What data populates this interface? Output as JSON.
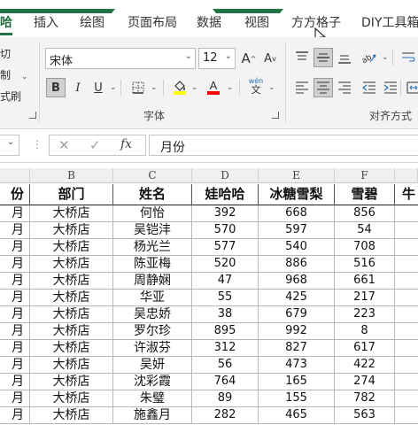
{
  "tabs": [
    {
      "label": "哈",
      "active": true
    },
    {
      "label": "插入"
    },
    {
      "label": "绘图"
    },
    {
      "label": "页面布局"
    },
    {
      "label": "数据"
    },
    {
      "label": "视图"
    },
    {
      "label": "方方格子"
    },
    {
      "label": "DIY工具箱"
    }
  ],
  "clipboard": {
    "cut": "切",
    "copy": "制",
    "format_painter": "式刷"
  },
  "font": {
    "name": "宋体",
    "size": "12",
    "grow_label": "A",
    "shrink_label": "A",
    "bold": "B",
    "italic": "I",
    "underline": "U",
    "phonetic_top": "wén",
    "phonetic_bottom": "文",
    "group_label": "字体"
  },
  "alignment": {
    "group_label": "对齐方式"
  },
  "colors": {
    "accent": "#217346",
    "highlight": "#ffff00",
    "font_color": "#ff0000"
  },
  "formula_bar": {
    "cancel": "✕",
    "confirm": "✓",
    "fx": "fx",
    "value": "月份"
  },
  "columns": [
    "B",
    "C",
    "D",
    "E",
    "F"
  ],
  "table": {
    "headers": [
      "份",
      "部门",
      "姓名",
      "娃哈哈",
      "冰糖雪梨",
      "雪碧",
      "牛"
    ],
    "rows": [
      [
        "月",
        "大桥店",
        "何怡",
        "392",
        "668",
        "856"
      ],
      [
        "月",
        "大桥店",
        "吴铠沣",
        "570",
        "597",
        "54"
      ],
      [
        "月",
        "大桥店",
        "杨光兰",
        "577",
        "540",
        "708"
      ],
      [
        "月",
        "大桥店",
        "陈亚梅",
        "520",
        "886",
        "516"
      ],
      [
        "月",
        "大桥店",
        "周静娴",
        "47",
        "968",
        "661"
      ],
      [
        "月",
        "大桥店",
        "华亚",
        "55",
        "425",
        "217"
      ],
      [
        "月",
        "大桥店",
        "吴忠娇",
        "38",
        "679",
        "223"
      ],
      [
        "月",
        "大桥店",
        "罗尔珍",
        "895",
        "992",
        "8"
      ],
      [
        "月",
        "大桥店",
        "许淑芬",
        "312",
        "827",
        "617"
      ],
      [
        "月",
        "大桥店",
        "吴妍",
        "56",
        "473",
        "422"
      ],
      [
        "月",
        "大桥店",
        "沈彩霞",
        "764",
        "165",
        "274"
      ],
      [
        "月",
        "大桥店",
        "朱璧",
        "89",
        "155",
        "782"
      ],
      [
        "月",
        "大桥店",
        "施鑫月",
        "282",
        "465",
        "563"
      ]
    ]
  }
}
